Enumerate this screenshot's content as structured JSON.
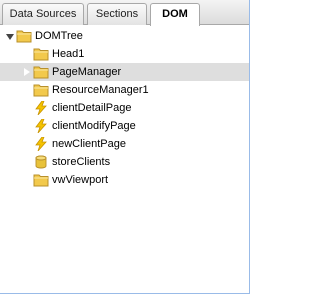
{
  "tabs": [
    {
      "label": "Data Sources",
      "active": false
    },
    {
      "label": "Sections",
      "active": false
    },
    {
      "label": "DOM",
      "active": true
    }
  ],
  "tree": {
    "root": {
      "label": "DOMTree",
      "icon": "folder-icon",
      "expanded": true
    },
    "children": [
      {
        "label": "Head1",
        "icon": "folder-icon",
        "selected": false
      },
      {
        "label": "PageManager",
        "icon": "folder-icon",
        "selected": true
      },
      {
        "label": "ResourceManager1",
        "icon": "folder-icon",
        "selected": false
      },
      {
        "label": "clientDetailPage",
        "icon": "lightning-icon",
        "selected": false
      },
      {
        "label": "clientModifyPage",
        "icon": "lightning-icon",
        "selected": false
      },
      {
        "label": "newClientPage",
        "icon": "lightning-icon",
        "selected": false
      },
      {
        "label": "storeClients",
        "icon": "database-icon",
        "selected": false
      },
      {
        "label": "vwViewport",
        "icon": "folder-icon",
        "selected": false
      }
    ]
  },
  "colors": {
    "folder": "#f2c94c",
    "lightning": "#f5c400",
    "database": "#e8c23a",
    "selection": "#dedede"
  }
}
